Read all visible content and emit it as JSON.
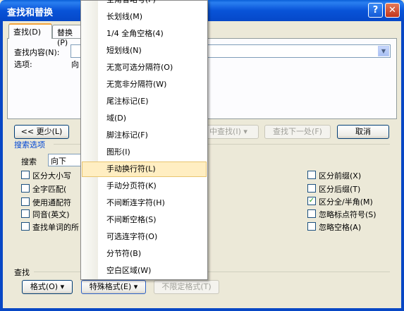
{
  "window": {
    "title": "查找和替换",
    "help": "?",
    "close": "✕"
  },
  "tabs": [
    {
      "label": "查找(D)"
    },
    {
      "label": "替换(P)"
    }
  ],
  "find": {
    "label": "查找内容(N):",
    "value": "",
    "options_label": "选项:",
    "options_value": "向"
  },
  "buttons": {
    "less": "<< 更少(L)",
    "find_prev": "中查找(I) ▾",
    "find_next": "查找下一处(F)",
    "cancel": "取消"
  },
  "search_options": {
    "title": "搜索选项",
    "direction_label": "搜索",
    "direction_value": "向下",
    "left": [
      {
        "label": "区分大小写",
        "checked": false
      },
      {
        "label": "全字匹配(",
        "checked": false
      },
      {
        "label": "使用通配符",
        "checked": false
      },
      {
        "label": "同音(英文)",
        "checked": false
      },
      {
        "label": "查找单词的所",
        "checked": false
      }
    ],
    "right": [
      {
        "label": "区分前缀(X)",
        "checked": false
      },
      {
        "label": "区分后缀(T)",
        "checked": false
      },
      {
        "label": "区分全/半角(M)",
        "checked": true
      },
      {
        "label": "忽略标点符号(S)",
        "checked": false
      },
      {
        "label": "忽略空格(A)",
        "checked": false
      }
    ]
  },
  "find_group": {
    "title": "查找",
    "format_btn": "格式(O) ▾",
    "special_btn": "特殊格式(E) ▾",
    "no_format_btn": "不限定格式(T)"
  },
  "menu": {
    "items": [
      {
        "label": "全角省略号(F)"
      },
      {
        "label": "长划线(M)"
      },
      {
        "label": "1/4 全角空格(4)"
      },
      {
        "label": "短划线(N)"
      },
      {
        "label": "无宽可选分隔符(O)"
      },
      {
        "label": "无宽非分隔符(W)"
      },
      {
        "label": "尾注标记(E)"
      },
      {
        "label": "域(D)"
      },
      {
        "label": "脚注标记(F)"
      },
      {
        "label": "图形(I)"
      },
      {
        "label": "手动换行符(L)",
        "highlighted": true
      },
      {
        "label": "手动分页符(K)"
      },
      {
        "label": "不间断连字符(H)"
      },
      {
        "label": "不间断空格(S)"
      },
      {
        "label": "可选连字符(O)"
      },
      {
        "label": "分节符(B)"
      },
      {
        "label": "空白区域(W)"
      }
    ]
  }
}
